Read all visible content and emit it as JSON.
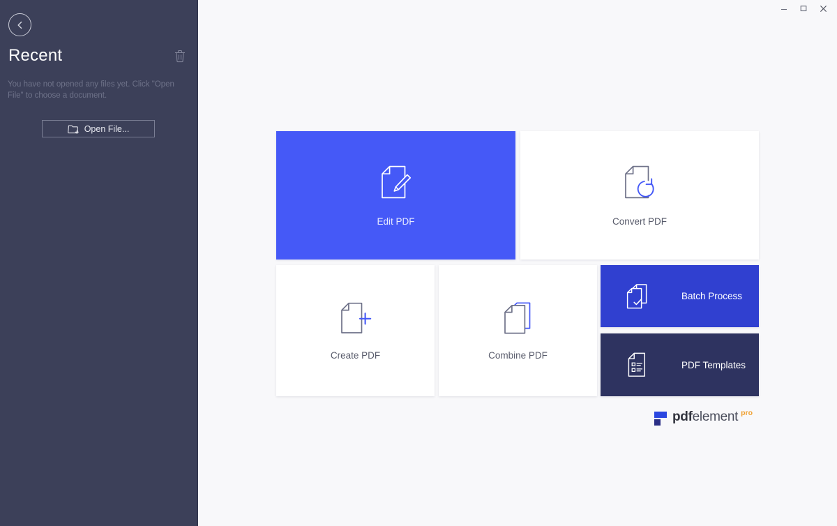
{
  "window": {
    "controls": [
      {
        "name": "minimize",
        "glyph": "minimize-icon"
      },
      {
        "name": "maximize",
        "glyph": "maximize-icon"
      },
      {
        "name": "close",
        "glyph": "close-icon"
      }
    ]
  },
  "sidebar": {
    "back_icon": "chevron-left-circle-icon",
    "title": "Recent",
    "clear_icon": "trash-icon",
    "empty_message": "You have not opened any files yet. Click \"Open File\" to choose a document.",
    "open_file_label": "Open File...",
    "open_file_icon": "folder-plus-icon",
    "background_color": "#3c4059"
  },
  "main": {
    "background_color": "#f8f8fa",
    "tiles": [
      {
        "id": "edit",
        "label": "Edit PDF",
        "icon": "document-pencil-icon",
        "background_color": "#4559f7",
        "text_color": "#e7eaff",
        "style": "large-primary"
      },
      {
        "id": "convert",
        "label": "Convert PDF",
        "icon": "document-refresh-icon",
        "background_color": "#ffffff",
        "text_color": "#585b6b",
        "style": "large"
      },
      {
        "id": "create",
        "label": "Create PDF",
        "icon": "document-plus-icon",
        "background_color": "#ffffff",
        "text_color": "#585b6b",
        "style": "large"
      },
      {
        "id": "combine",
        "label": "Combine PDF",
        "icon": "documents-stack-icon",
        "background_color": "#ffffff",
        "text_color": "#585b6b",
        "style": "large"
      },
      {
        "id": "batch",
        "label": "Batch Process",
        "icon": "documents-check-icon",
        "background_color": "#3040d0",
        "text_color": "#ffffff",
        "style": "wide"
      },
      {
        "id": "templates",
        "label": "PDF Templates",
        "icon": "document-list-icon",
        "background_color": "#2e3360",
        "text_color": "#ffffff",
        "style": "wide"
      }
    ]
  },
  "logo": {
    "mark_icon": "pdfelement-logo-mark",
    "name_bold": "pdf",
    "name_light": "element",
    "badge": "pro",
    "badge_color": "#f0a030",
    "mark_color": "#2b47e0"
  }
}
